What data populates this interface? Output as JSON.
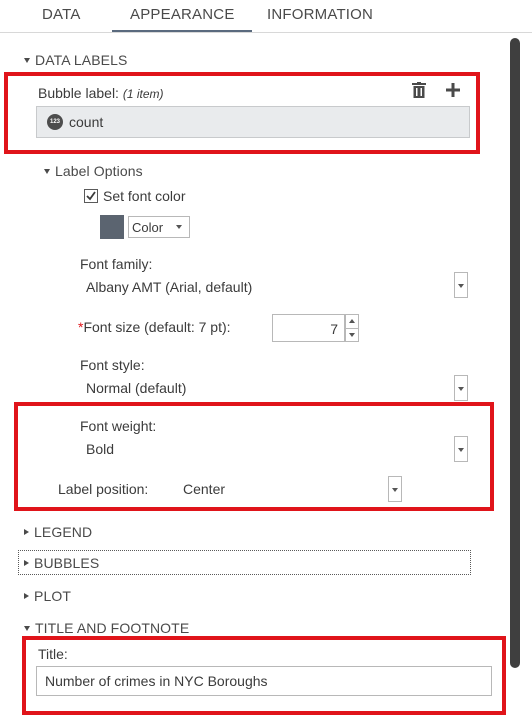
{
  "tabs": [
    {
      "label": "DATA"
    },
    {
      "label": "APPEARANCE"
    },
    {
      "label": "INFORMATION"
    }
  ],
  "active_tab": "APPEARANCE",
  "data_labels": {
    "section_title": "DATA LABELS",
    "bubble_label_title": "Bubble label:",
    "bubble_label_count": "(1 item)",
    "item_icon_text": "123",
    "item_label": "count",
    "label_options_title": "Label Options",
    "set_font_color_label": "Set font color",
    "set_font_color_checked": true,
    "swatch_color": "#5b6470",
    "color_button_label": "Color",
    "font_family_label": "Font family:",
    "font_family_value": "Albany AMT (Arial, default)",
    "font_size_label": "Font size (default: 7 pt):",
    "font_size_required_mark": "*",
    "font_size_value": "7",
    "font_style_label": "Font style:",
    "font_style_value": "Normal (default)",
    "font_weight_label": "Font weight:",
    "font_weight_value": "Bold",
    "label_position_label": "Label position:",
    "label_position_value": "Center"
  },
  "sections": {
    "legend": "LEGEND",
    "bubbles": "BUBBLES",
    "plot": "PLOT",
    "title_footnote": "TITLE AND FOOTNOTE"
  },
  "title_field": {
    "label": "Title:",
    "value": "Number of crimes in NYC Boroughs"
  },
  "colors": {
    "highlight": "#e0141a",
    "tab_underline": "#5a6a7e",
    "list_bg": "#e9ebed"
  }
}
